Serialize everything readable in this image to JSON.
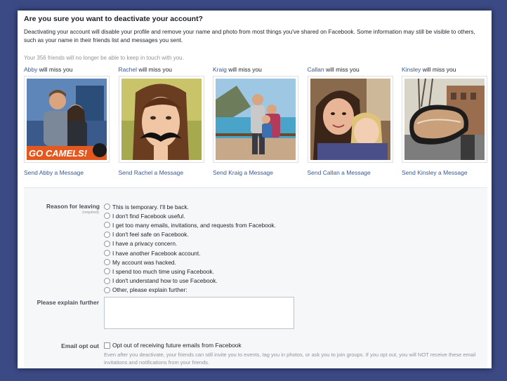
{
  "dialog": {
    "title": "Are you sure you want to deactivate your account?",
    "description": "Deactivating your account will disable your profile and remove your name and photo from most things you've shared on Facebook. Some information may still be visible to others, such as your name in their friends list and messages you sent.",
    "friends_note": "Your 356 friends will no longer be able to keep in touch with you."
  },
  "miss_suffix": " will miss you",
  "friends": [
    {
      "name": "Abby",
      "send": "Send Abby a Message",
      "photo_caption": "GO CAMELS!"
    },
    {
      "name": "Rachel",
      "send": "Send Rachel a Message"
    },
    {
      "name": "Kraig",
      "send": "Send Kraig a Message"
    },
    {
      "name": "Callan",
      "send": "Send Callan a Message"
    },
    {
      "name": "Kinsley",
      "send": "Send Kinsley a Message"
    }
  ],
  "form": {
    "reason_label": "Reason for leaving",
    "required_label": "(required)",
    "reasons": [
      "This is temporary. I'll be back.",
      "I don't find Facebook useful.",
      "I get too many emails, invitations, and requests from Facebook.",
      "I don't feel safe on Facebook.",
      "I have a privacy concern.",
      "I have another Facebook account.",
      "My account was hacked.",
      "I spend too much time using Facebook.",
      "I don't understand how to use Facebook.",
      "Other, please explain further:"
    ],
    "explain_label": "Please explain further",
    "explain_value": "",
    "email_label": "Email opt out",
    "email_option": "Opt out of receiving future emails from Facebook",
    "email_note": "Even after you deactivate, your friends can still invite you to events, tag you in photos, or ask you to join groups. If you opt out, you will NOT receive these email invitations and notifications from your friends."
  },
  "colors": {
    "link": "#365899",
    "page_bg": "#3b4a85",
    "panel_bg": "#f6f7f9"
  }
}
